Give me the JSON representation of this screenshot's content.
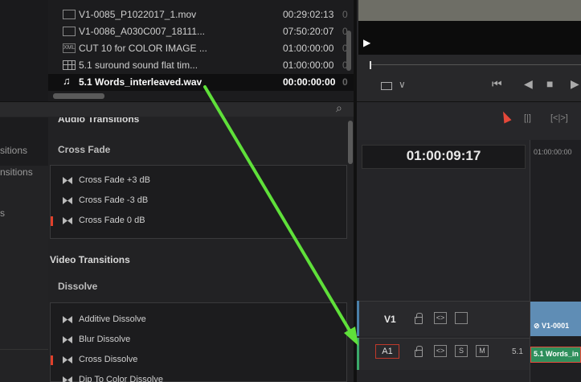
{
  "gutter": {
    "items": [
      "sitions",
      "nsitions",
      "s"
    ]
  },
  "media_pool": {
    "rows": [
      {
        "name": "V1-0085_P1022017_1.mov",
        "tc": "00:29:02:13",
        "extra": "0",
        "icon": "clip-icon"
      },
      {
        "name": "V1-0086_A030C007_18111...",
        "tc": "07:50:20:07",
        "extra": "0",
        "icon": "clip-icon"
      },
      {
        "name": "CUT 10 for COLOR IMAGE ...",
        "tc": "01:00:00:00",
        "extra": "0",
        "icon": "xml-icon",
        "icon_text": "XML"
      },
      {
        "name": "5.1 suround sound flat tim...",
        "tc": "01:00:00:00",
        "extra": "0",
        "icon": "timeline-icon"
      },
      {
        "name": "5.1 Words_interleaved.wav",
        "tc": "00:00:00:00",
        "extra": "0",
        "icon": "music-note-icon",
        "selected": true
      }
    ]
  },
  "viewer": {
    "play_icon": "▶",
    "chevron": "∨",
    "transport": [
      "⏮",
      "◀",
      "■",
      "▶"
    ]
  },
  "effects": {
    "search_icon": "⌕",
    "audio_section": "Audio Transitions",
    "audio_category": "Cross Fade",
    "audio_items": [
      "Cross Fade +3 dB",
      "Cross Fade -3 dB",
      "Cross Fade 0 dB"
    ],
    "video_section": "Video Transitions",
    "video_category": "Dissolve",
    "video_items": [
      "Additive Dissolve",
      "Blur Dissolve",
      "Cross Dissolve",
      "Dip To Color Dissolve"
    ]
  },
  "timeline": {
    "timecode": "01:00:09:17",
    "ruler_timecode": "01:00:00:00",
    "tool_icons": [
      "[|]",
      "[<|>]"
    ],
    "tracks": {
      "v1": {
        "label": "V1",
        "clip_label": "V1-0001"
      },
      "a1": {
        "label": "A1",
        "channel": "5.1",
        "clip_label": "5.1 Words_in",
        "buttons": [
          "S",
          "M"
        ]
      }
    }
  },
  "annotation": {
    "arrow_color": "#5fe03a"
  }
}
